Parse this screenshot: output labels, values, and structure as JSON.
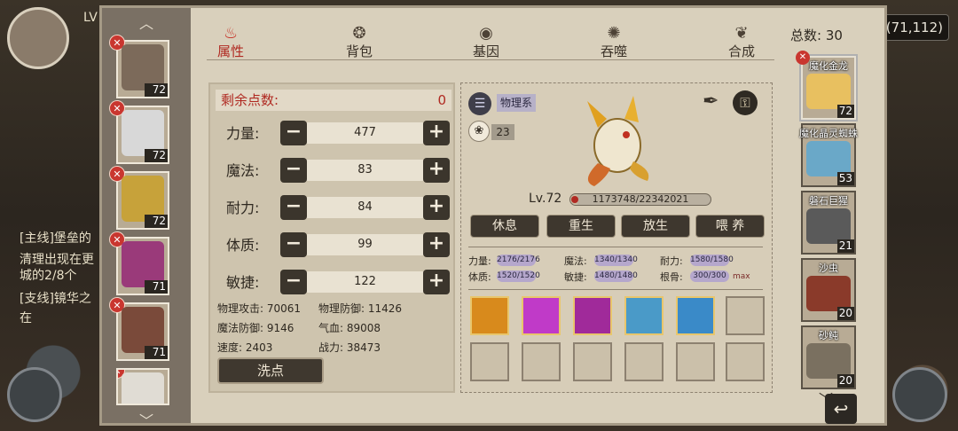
{
  "background": {
    "map_label": "城(71,112)",
    "left_quests": [
      "LV",
      "[主线]堡垒的",
      "清理出现在更",
      "城的2/8个",
      "[支线]镜华之",
      "在"
    ]
  },
  "tabs": [
    {
      "label": "属性",
      "icon": "flame-icon",
      "active": true
    },
    {
      "label": "背包",
      "icon": "bag-icon",
      "active": false
    },
    {
      "label": "基因",
      "icon": "eye-icon",
      "active": false
    },
    {
      "label": "吞噬",
      "icon": "swirl-icon",
      "active": false
    },
    {
      "label": "合成",
      "icon": "shell-icon",
      "active": false
    }
  ],
  "left_pets": [
    {
      "level": "72",
      "color": "#7c6a5a"
    },
    {
      "level": "72",
      "color": "#d8d8d8"
    },
    {
      "level": "72",
      "color": "#c7a23a"
    },
    {
      "level": "71",
      "color": "#9a3a7a"
    },
    {
      "level": "71",
      "color": "#7a4a3a"
    },
    {
      "level": "",
      "color": "#e0dcd4"
    }
  ],
  "points": {
    "title": "剩余点数:",
    "value": "0",
    "attributes": [
      {
        "name": "力量:",
        "value": "477"
      },
      {
        "name": "魔法:",
        "value": "83"
      },
      {
        "name": "耐力:",
        "value": "84"
      },
      {
        "name": "体质:",
        "value": "99"
      },
      {
        "name": "敏捷:",
        "value": "122"
      }
    ],
    "derived": [
      "物理攻击: 70061",
      "物理防御: 11426",
      "魔法防御: 9146",
      "气血: 89008",
      "速度: 2403",
      "战力: 38473"
    ],
    "reset_label": "洗点"
  },
  "detail": {
    "type_label": "物理系",
    "paw_count": "23",
    "level": "Lv.72",
    "hp": "1173748/22342021",
    "hp_fraction": 0.05,
    "actions": [
      "休息",
      "重生",
      "放生",
      "喂 养"
    ],
    "stats": [
      {
        "label": "力量:",
        "value": "2176/2176"
      },
      {
        "label": "魔法:",
        "value": "1340/1340"
      },
      {
        "label": "耐力:",
        "value": "1580/1580"
      },
      {
        "label": "体质:",
        "value": "1520/1520"
      },
      {
        "label": "敏捷:",
        "value": "1480/1480"
      },
      {
        "label": "根骨:",
        "value": "300/300"
      }
    ],
    "max_label": "max",
    "skills": [
      {
        "icon": "flame-burst-icon",
        "color": "#d88a1c"
      },
      {
        "icon": "claw-slash-icon",
        "color": "#c03ac8"
      },
      {
        "icon": "dark-burst-icon",
        "color": "#a02a9a"
      },
      {
        "icon": "ice-beast-icon",
        "color": "#4a9ac8"
      },
      {
        "icon": "wind-slash-icon",
        "color": "#3a8ac8"
      },
      {
        "icon": "",
        "color": ""
      },
      {
        "icon": "",
        "color": ""
      },
      {
        "icon": "",
        "color": ""
      },
      {
        "icon": "",
        "color": ""
      },
      {
        "icon": "",
        "color": ""
      },
      {
        "icon": "",
        "color": ""
      },
      {
        "icon": "",
        "color": ""
      }
    ]
  },
  "roster": {
    "total": "总数: 30",
    "pets": [
      {
        "name": "魔化金龙",
        "level": "72",
        "color": "#e8c060",
        "selected": true
      },
      {
        "name": "魔化晶灵蜘蛛",
        "level": "53",
        "color": "#6aa8c8",
        "selected": false
      },
      {
        "name": "磐石巨猩",
        "level": "21",
        "color": "#5a5a5a",
        "selected": false
      },
      {
        "name": "沙虫",
        "level": "20",
        "color": "#8a3a2a",
        "selected": false
      },
      {
        "name": "砂鲀",
        "level": "20",
        "color": "#7a7060",
        "selected": false
      }
    ]
  }
}
